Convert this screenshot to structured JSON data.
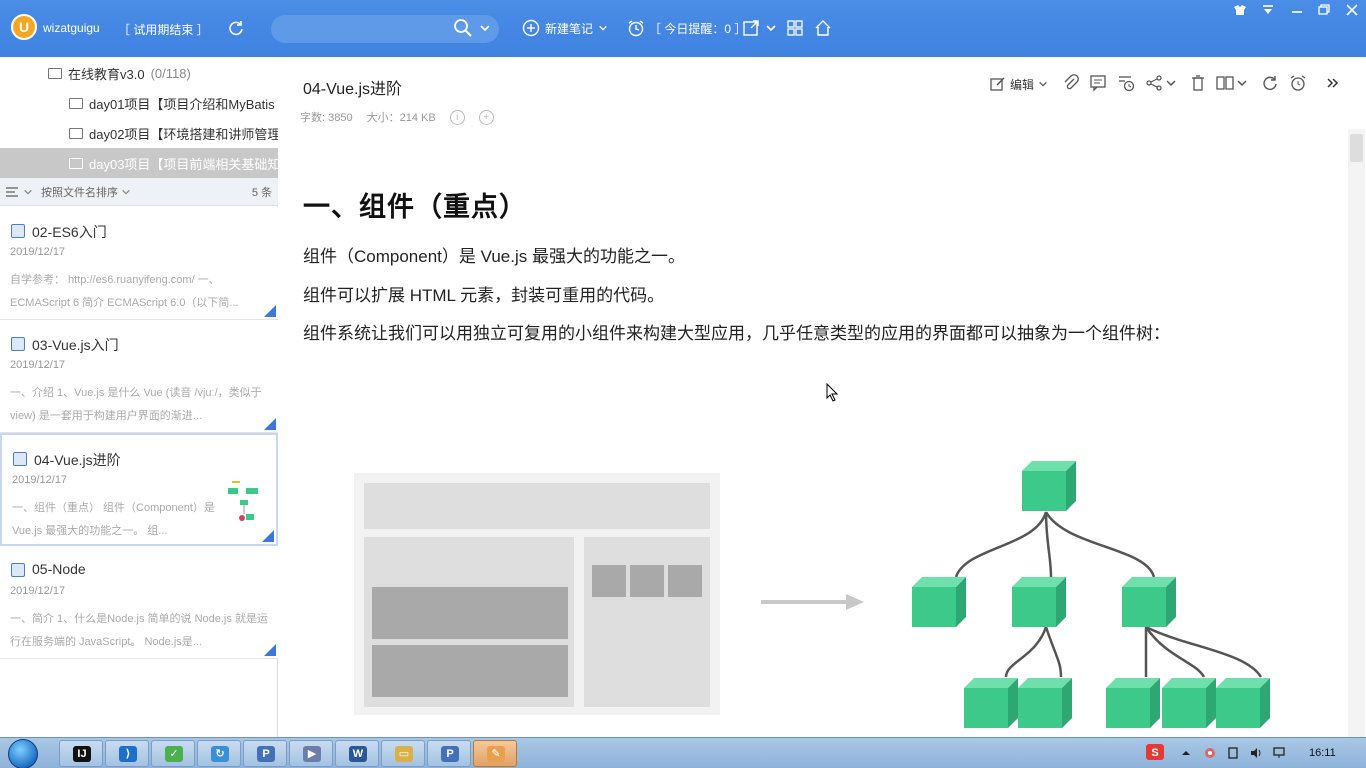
{
  "app": {
    "username": "wizatguigu",
    "trial_status": "［ 试用期结束 ］",
    "new_note_label": "新建笔记",
    "reminder_label": "［ 今日提醒：0 ］"
  },
  "tree": {
    "items": [
      {
        "label": "在线教育v3.0",
        "count": "(0/118)"
      },
      {
        "label": "day01项目【项目介绍和MyBatis"
      },
      {
        "label": "day02项目【环境搭建和讲师管理"
      },
      {
        "label": "day03项目【项目前端相关基础知"
      }
    ]
  },
  "list": {
    "sort_label": "按照文件名排序",
    "count_label": "5 条",
    "notes": [
      {
        "title": "02-ES6入门",
        "date": "2019/12/17",
        "excerpt": "自学参考： http://es6.ruanyifeng.com/ 一、ECMAScript 6 简介 ECMAScript 6.0（以下简..."
      },
      {
        "title": "03-Vue.js入门",
        "date": "2019/12/17",
        "excerpt": "一、介绍 1、Vue.js 是什么 Vue (读音 /vjuː/，类似于 view) 是一套用于构建用户界面的渐进..."
      },
      {
        "title": "04-Vue.js进阶",
        "date": "2019/12/17",
        "excerpt": "一、组件（重点） 组件（Component）是 Vue.js 最强大的功能之一。 组..."
      },
      {
        "title": "05-Node",
        "date": "2019/12/17",
        "excerpt": "一、简介 1、什么是Node.js 简单的说 Node.js 就是运行在服务端的 JavaScript。 Node.js是..."
      }
    ]
  },
  "note": {
    "title": "04-Vue.js进阶",
    "word_count": "字数: 3850",
    "size": "大小：214 KB",
    "edit_label": "编辑",
    "heading": "一、组件（重点）",
    "paragraphs": [
      "组件（Component）是 Vue.js 最强大的功能之一。",
      "组件可以扩展 HTML 元素，封装可重用的代码。",
      "组件系统让我们可以用独立可复用的小组件来构建大型应用，几乎任意类型的应用的界面都可以抽象为一个组件树："
    ]
  },
  "taskbar": {
    "clock": "16:11"
  },
  "colors": {
    "toolbar": "#4a8de6",
    "component_green": "#3dc98a",
    "accent_blue": "#3c78d8"
  }
}
